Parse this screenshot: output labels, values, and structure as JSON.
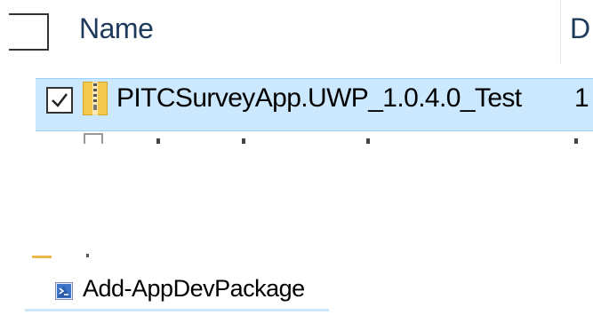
{
  "file_list": {
    "header": {
      "name_label": "Name",
      "next_column_label": "D"
    },
    "rows": [
      {
        "name": "PITCSurveyApp.UWP_1.0.4.0_Test",
        "next_column_value": "1",
        "selected": true,
        "checked": true,
        "icon": "zip-folder-icon"
      },
      {
        "icon": "file-icon",
        "partially_visible": true
      }
    ]
  },
  "lower_list": {
    "rows": [
      {
        "icon": "folder-icon",
        "partially_visible": true
      },
      {
        "name": "Add-AppDevPackage",
        "icon": "powershell-script-icon"
      }
    ]
  },
  "colors": {
    "selection_background": "#cce8ff",
    "selection_border": "#99d1ff",
    "header_text": "#1e395b"
  }
}
